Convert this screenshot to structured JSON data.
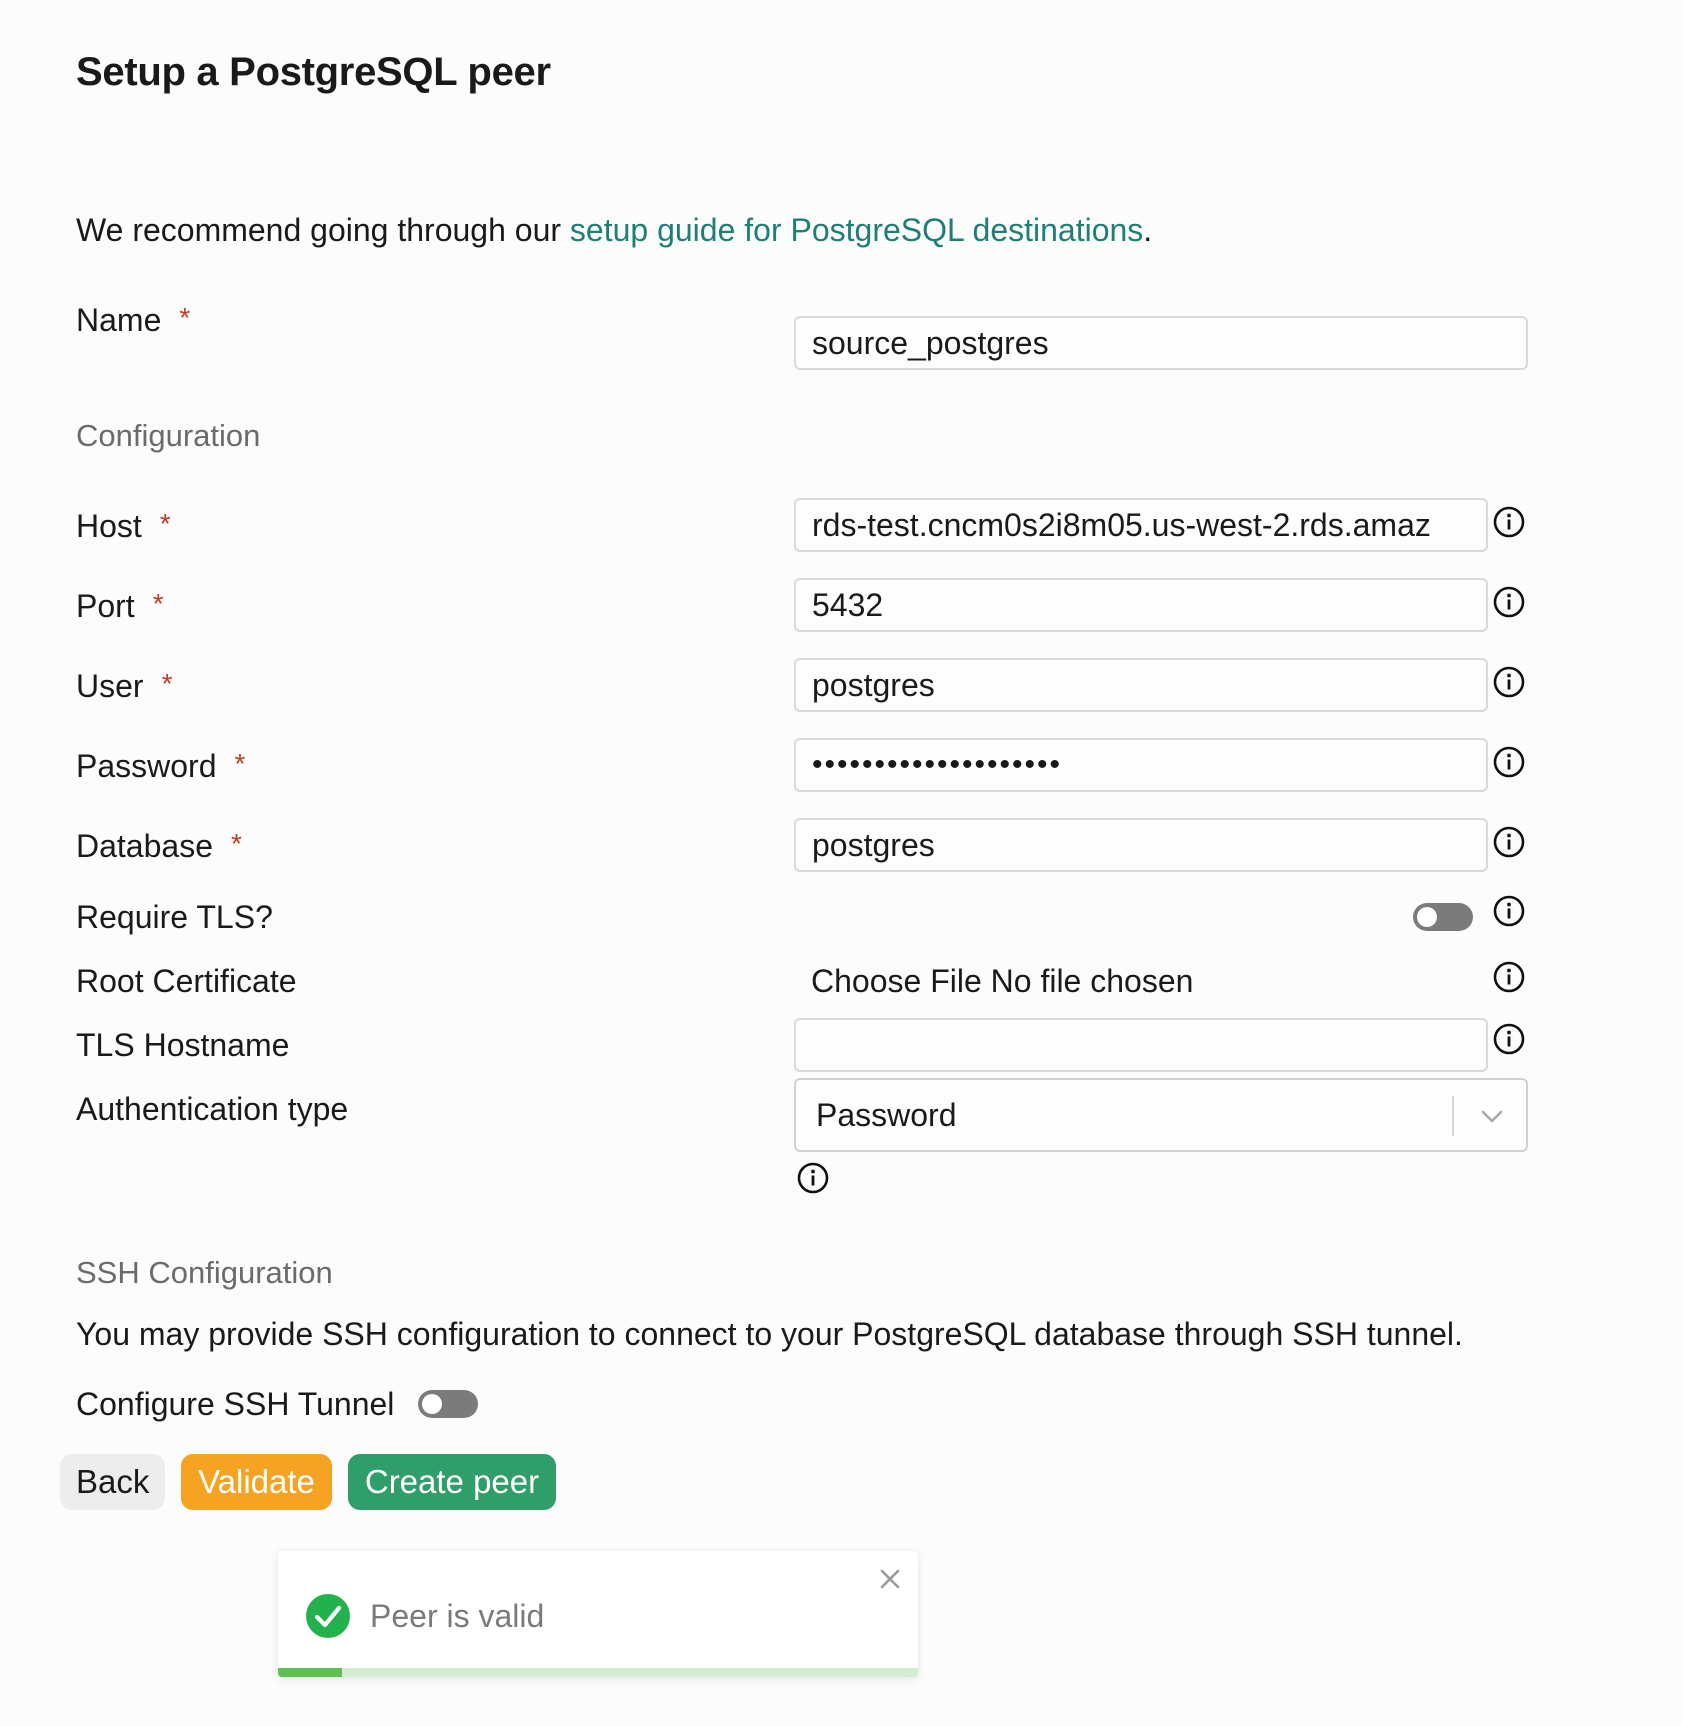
{
  "page": {
    "title": "Setup a PostgreSQL peer",
    "intro_text": "We recommend going through our ",
    "intro_link": "setup guide for PostgreSQL destinations",
    "intro_suffix": "."
  },
  "form": {
    "name": {
      "label": "Name",
      "required_mark": "*",
      "value": "source_postgres"
    },
    "configuration_heading": "Configuration",
    "host": {
      "label": "Host",
      "required_mark": "*",
      "value": "rds-test.cncm0s2i8m05.us-west-2.rds.amaz"
    },
    "port": {
      "label": "Port",
      "required_mark": "*",
      "value": "5432"
    },
    "user": {
      "label": "User",
      "required_mark": "*",
      "value": "postgres"
    },
    "password": {
      "label": "Password",
      "required_mark": "*",
      "value": "••••••••••••••••••••"
    },
    "database": {
      "label": "Database",
      "required_mark": "*",
      "value": "postgres"
    },
    "require_tls": {
      "label": "Require TLS?",
      "enabled": false
    },
    "root_certificate": {
      "label": "Root Certificate",
      "file_text": "Choose File No file chosen"
    },
    "tls_hostname": {
      "label": "TLS Hostname",
      "value": ""
    },
    "auth_type": {
      "label": "Authentication type",
      "selected": "Password"
    }
  },
  "ssh": {
    "heading": "SSH Configuration",
    "description": "You may provide SSH configuration to connect to your PostgreSQL database through SSH tunnel.",
    "toggle_label": "Configure SSH Tunnel",
    "enabled": false
  },
  "actions": {
    "back": "Back",
    "validate": "Validate",
    "create": "Create peer"
  },
  "toast": {
    "message": "Peer is valid",
    "progress": 0.1
  },
  "colors": {
    "link": "#1d7f76",
    "required": "#c43a1f",
    "validate": "#f6a323",
    "create": "#2f9e6a",
    "success": "#22b14c"
  }
}
